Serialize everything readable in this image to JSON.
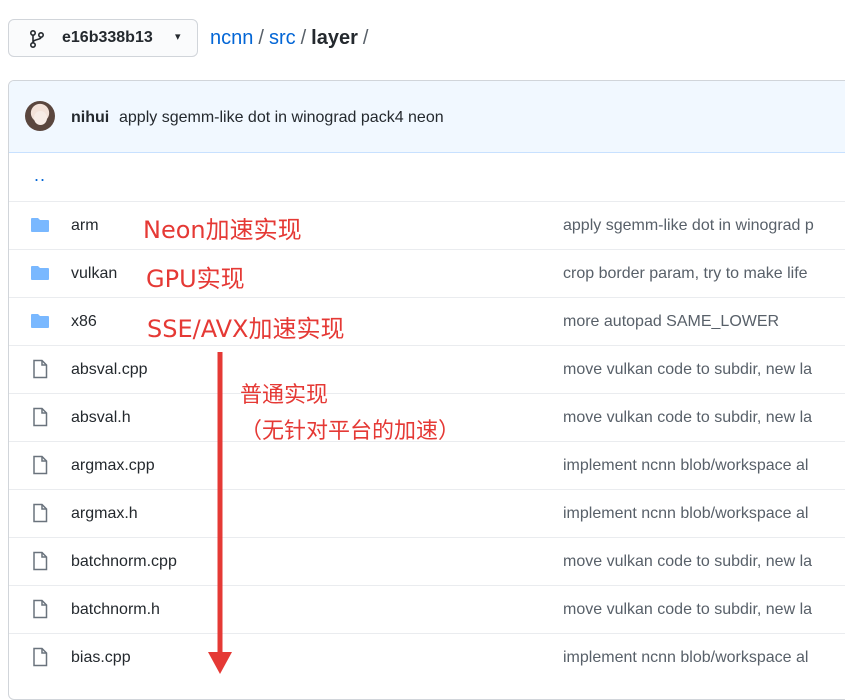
{
  "branch": {
    "name": "e16b338b13",
    "icon": "git-branch-icon",
    "caret": "▾"
  },
  "breadcrumb": {
    "repo": "ncnn",
    "sep1": "/",
    "dir": "src",
    "sep2": "/",
    "current": "layer",
    "sep3": "/"
  },
  "commit": {
    "author": "nihui",
    "message": "apply sgemm-like dot in winograd pack4 neon"
  },
  "parent_dir": "..",
  "files": [
    {
      "type": "folder",
      "name": "arm",
      "message": "apply sgemm-like dot in winograd p"
    },
    {
      "type": "folder",
      "name": "vulkan",
      "message": "crop border param, try to make life"
    },
    {
      "type": "folder",
      "name": "x86",
      "message": "more autopad SAME_LOWER"
    },
    {
      "type": "file",
      "name": "absval.cpp",
      "message": "move vulkan code to subdir, new la"
    },
    {
      "type": "file",
      "name": "absval.h",
      "message": "move vulkan code to subdir, new la"
    },
    {
      "type": "file",
      "name": "argmax.cpp",
      "message": "implement ncnn blob/workspace al"
    },
    {
      "type": "file",
      "name": "argmax.h",
      "message": "implement ncnn blob/workspace al"
    },
    {
      "type": "file",
      "name": "batchnorm.cpp",
      "message": "move vulkan code to subdir, new la"
    },
    {
      "type": "file",
      "name": "batchnorm.h",
      "message": "move vulkan code to subdir, new la"
    },
    {
      "type": "file",
      "name": "bias.cpp",
      "message": "implement ncnn blob/workspace al"
    }
  ],
  "annotations": {
    "neon": "Neon加速实现",
    "gpu": "GPU实现",
    "sse": "SSE/AVX加速实现",
    "normal_line1": "普通实现",
    "normal_line2": "（无针对平台的加速）"
  },
  "colors": {
    "link": "#0366d6",
    "folder": "#79b8ff",
    "annotation": "#e53935",
    "commit_bg": "#f1f8ff"
  }
}
